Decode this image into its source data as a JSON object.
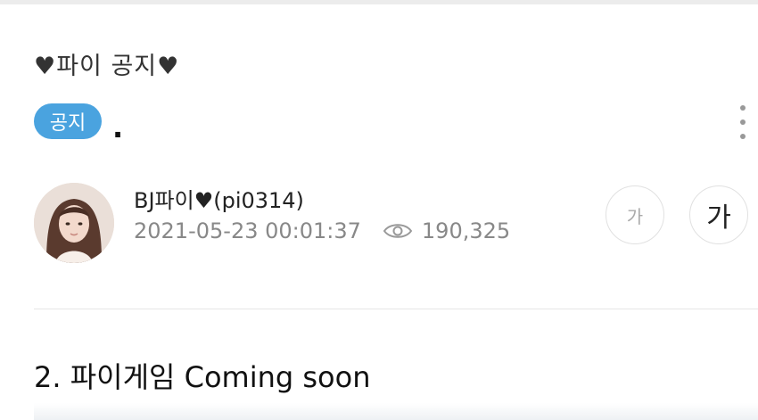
{
  "post": {
    "category": "♥파이 공지♥",
    "badge": "공지",
    "title": ".",
    "author": "BJ파이♥(pi0314)",
    "datetime": "2021-05-23 00:01:37",
    "views": "190,325"
  },
  "font_controls": {
    "smaller": "가",
    "larger": "가"
  },
  "content": {
    "heading": "2. 파이게임 Coming soon"
  },
  "icons": {
    "menu": "more-vertical-icon",
    "views": "eye-icon"
  },
  "colors": {
    "badge": "#4aa3df",
    "meta": "#888888"
  }
}
